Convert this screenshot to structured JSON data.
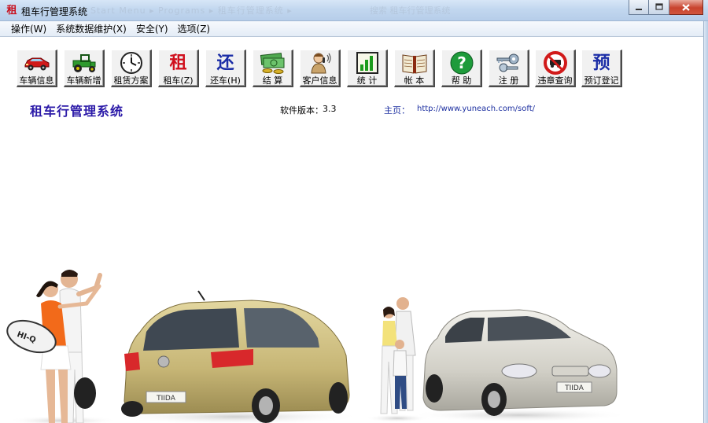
{
  "window": {
    "title": "租车行管理系统",
    "app_icon_glyph": "租",
    "ghost_breadcrumb": "Start Menu  ▸  Programs  ▸  租车行管理系统  ▸",
    "ghost_search": "搜索 租车行管理系统",
    "controls": {
      "minimize": "minimize-icon",
      "maximize": "maximize-icon",
      "close": "close-icon"
    }
  },
  "menu": [
    {
      "label": "操作(W)"
    },
    {
      "label": "系统数据维护(X)"
    },
    {
      "label": "安全(Y)"
    },
    {
      "label": "选项(Z)"
    }
  ],
  "toolbar": [
    {
      "label": "车辆信息",
      "icon": "red-car-icon"
    },
    {
      "label": "车辆新增",
      "icon": "green-tractor-icon"
    },
    {
      "label": "租赁方案",
      "icon": "clock-icon"
    },
    {
      "label": "租车(Z)",
      "icon": "rent-glyph-icon",
      "glyph": "租"
    },
    {
      "label": "还车(H)",
      "icon": "return-glyph-icon",
      "glyph": "还"
    },
    {
      "label": "结 算",
      "icon": "money-icon"
    },
    {
      "label": "客户信息",
      "icon": "customer-icon"
    },
    {
      "label": "统 计",
      "icon": "bar-chart-icon"
    },
    {
      "label": "帐 本",
      "icon": "ledger-book-icon"
    },
    {
      "label": "帮 助",
      "icon": "help-icon"
    },
    {
      "label": "注 册",
      "icon": "keys-icon"
    },
    {
      "label": "违章查询",
      "icon": "no-entry-sign-icon"
    },
    {
      "label": "预订登记",
      "icon": "reserve-glyph-icon",
      "glyph": "预"
    }
  ],
  "info": {
    "system_title": "租车行管理系统",
    "version_label": "软件版本：",
    "version_value": "3.3",
    "home_label": "主页：",
    "home_url": "http://www.yuneach.com/soft/"
  },
  "colors": {
    "title_blue": "#2b1aa8",
    "link_blue": "#1c2fa0",
    "close_red": "#c8432d"
  }
}
